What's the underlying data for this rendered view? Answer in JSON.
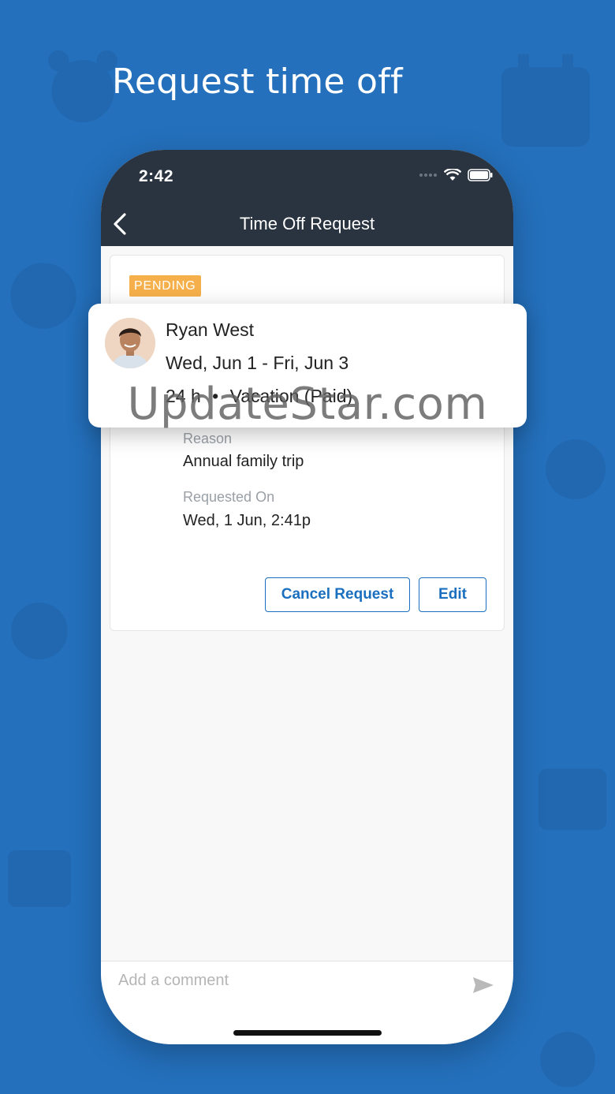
{
  "headline": "Request time off",
  "status_bar": {
    "time": "2:42"
  },
  "nav": {
    "title": "Time Off Request",
    "back_icon": "chevron-left-icon"
  },
  "request": {
    "status": "PENDING",
    "status_color": "#f5b04b",
    "employee": "Ryan West",
    "date_range": "Wed, Jun 1 - Fri, Jun 3",
    "hours": "24 h",
    "separator": "•",
    "type": "Vacation (Paid)",
    "reason_label": "Reason",
    "reason": "Annual family trip",
    "requested_on_label": "Requested On",
    "requested_on": "Wed, 1 Jun, 2:41p"
  },
  "actions": {
    "cancel": "Cancel Request",
    "edit": "Edit"
  },
  "watermark": "UpdateStar.com",
  "comment": {
    "placeholder": "Add a comment",
    "send_icon": "send-icon"
  },
  "colors": {
    "background": "#2470bc",
    "topbar": "#2a3441",
    "accent": "#1a6fbf"
  }
}
